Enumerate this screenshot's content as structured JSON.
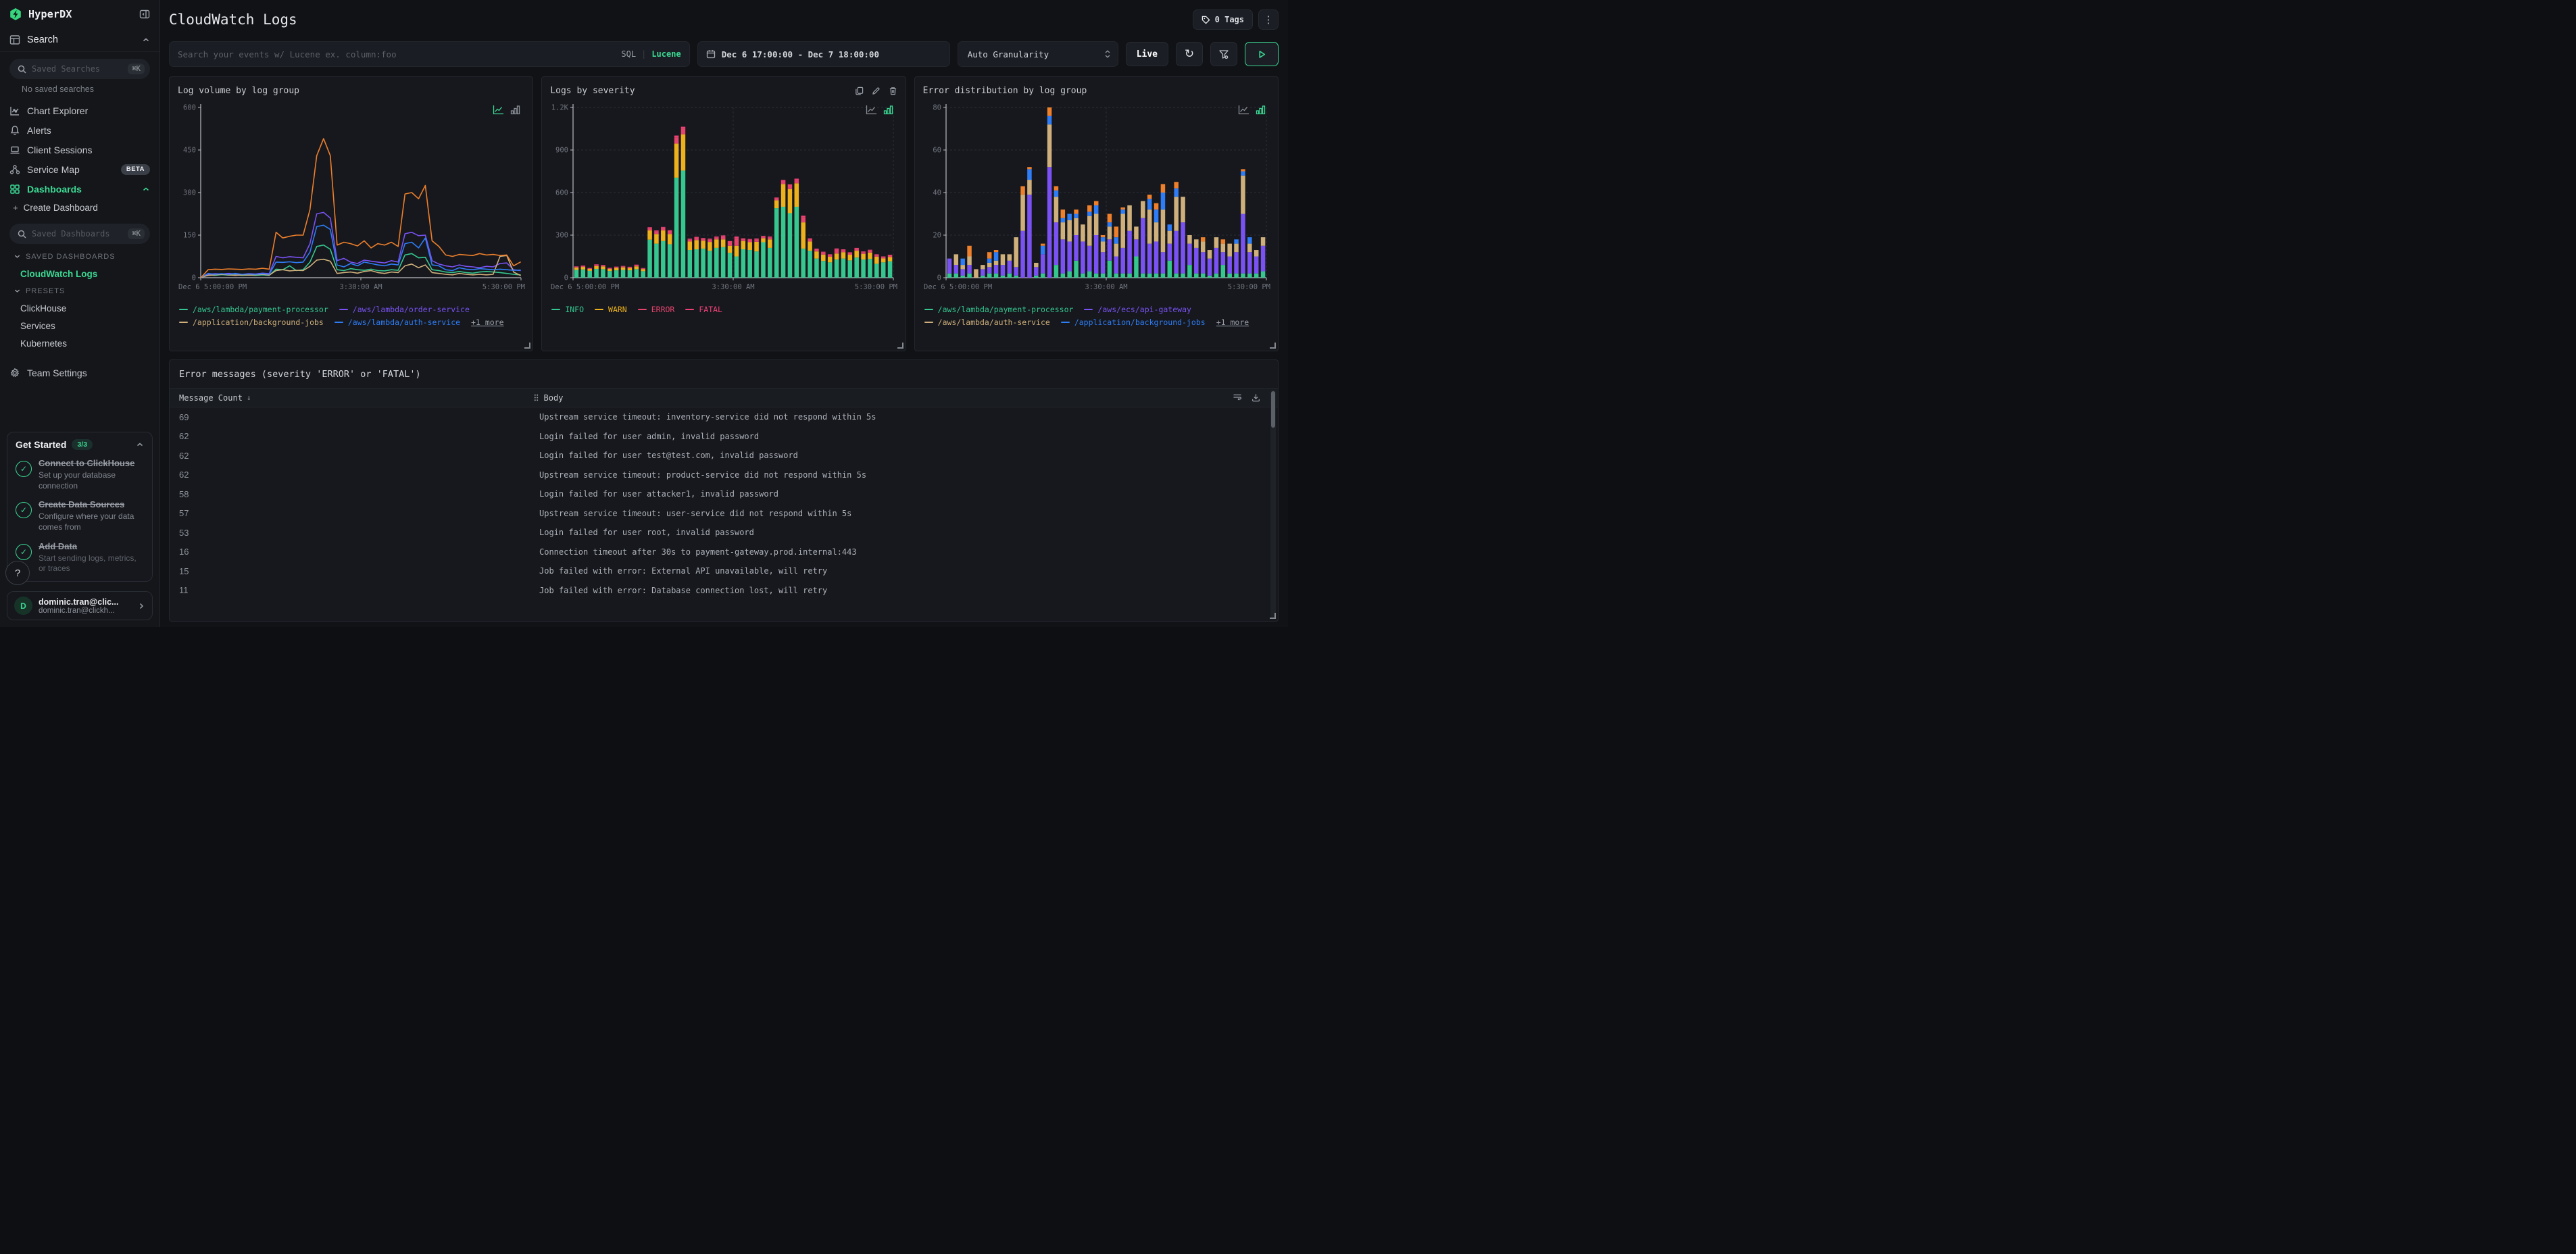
{
  "icons": {
    "kebab": "⋮",
    "refresh": "↻",
    "cmdk": "⌘K",
    "help": "?",
    "plus": "+",
    "sort_desc": "↓",
    "check": "✓",
    "avatar_letter": "D"
  },
  "sidebar": {
    "brand": "HyperDX",
    "search_section": {
      "label": "Search",
      "placeholder": "Saved Searches",
      "empty": "No saved searches"
    },
    "nav": [
      {
        "label": "Chart Explorer"
      },
      {
        "label": "Alerts"
      },
      {
        "label": "Client Sessions"
      },
      {
        "label": "Service Map",
        "badge": "BETA"
      },
      {
        "label": "Dashboards"
      }
    ],
    "dashboards": {
      "create": "Create Dashboard",
      "placeholder": "Saved Dashboards",
      "saved_label": "SAVED DASHBOARDS",
      "saved_items": [
        {
          "label": "CloudWatch Logs",
          "active": true
        }
      ],
      "presets_label": "PRESETS",
      "presets": [
        "ClickHouse",
        "Services",
        "Kubernetes"
      ]
    },
    "team_settings": "Team Settings",
    "get_started": {
      "title": "Get Started",
      "badge": "3/3",
      "items": [
        {
          "title": "Connect to ClickHouse",
          "desc": "Set up your database connection"
        },
        {
          "title": "Create Data Sources",
          "desc": "Configure where your data comes from"
        },
        {
          "title": "Add Data",
          "desc": "Start sending logs, metrics, or traces"
        }
      ]
    },
    "user": {
      "name": "dominic.tran@clic...",
      "email": "dominic.tran@clickh..."
    }
  },
  "header": {
    "title": "CloudWatch Logs",
    "tags": "0 Tags",
    "search_placeholder": "Search your events w/ Lucene ex. column:foo",
    "sql": "SQL",
    "pipe": "|",
    "lucene": "Lucene",
    "date_range": "Dec 6 17:00:00 - Dec 7 18:00:00",
    "granularity": "Auto Granularity",
    "live": "Live"
  },
  "chart_data": [
    {
      "type": "line",
      "title": "Log volume by log group",
      "active_view": "line",
      "grid": false,
      "ylim": [
        0,
        600
      ],
      "yticks": [
        [
          0,
          "0"
        ],
        [
          150,
          "150"
        ],
        [
          300,
          "300"
        ],
        [
          450,
          "450"
        ],
        [
          600,
          "600"
        ]
      ],
      "xticklabels": [
        "Dec 6 5:00:00 PM",
        "3:30:00 AM",
        "5:30:00 PM"
      ],
      "series": [
        {
          "name": "/aws/lambda/payment-processor",
          "color": "#35c78f",
          "values": [
            2,
            10,
            8,
            11,
            9,
            10,
            8,
            9,
            8,
            10,
            8,
            30,
            28,
            42,
            25,
            28,
            55,
            110,
            115,
            100,
            28,
            25,
            32,
            28,
            26,
            30,
            25,
            24,
            28,
            26,
            80,
            85,
            70,
            72,
            28,
            25,
            20,
            18,
            22,
            18,
            16,
            20,
            22,
            20,
            18,
            15,
            12,
            10
          ]
        },
        {
          "name": "/aws/lambda/order-service",
          "color": "#7a52f4",
          "values": [
            2,
            12,
            14,
            13,
            15,
            13,
            12,
            14,
            13,
            16,
            14,
            75,
            70,
            74,
            72,
            70,
            120,
            225,
            230,
            210,
            60,
            68,
            55,
            50,
            62,
            58,
            55,
            52,
            60,
            55,
            155,
            160,
            148,
            150,
            60,
            48,
            42,
            38,
            45,
            40,
            38,
            35,
            40,
            38,
            50,
            52,
            28,
            25
          ]
        },
        {
          "name": "/application/background-jobs",
          "color": "#cfb07c",
          "values": [
            2,
            8,
            10,
            12,
            10,
            8,
            10,
            9,
            10,
            12,
            9,
            25,
            28,
            24,
            26,
            25,
            40,
            62,
            65,
            58,
            15,
            18,
            20,
            16,
            22,
            25,
            18,
            15,
            20,
            18,
            42,
            48,
            35,
            45,
            18,
            15,
            12,
            10,
            15,
            12,
            10,
            12,
            10,
            12,
            75,
            78,
            20,
            8
          ]
        },
        {
          "name": "/aws/lambda/auth-service",
          "color": "#2e7df6",
          "values": [
            2,
            15,
            12,
            14,
            12,
            15,
            12,
            13,
            12,
            14,
            12,
            55,
            54,
            56,
            53,
            55,
            90,
            180,
            185,
            170,
            45,
            38,
            50,
            42,
            55,
            50,
            45,
            42,
            48,
            45,
            120,
            125,
            105,
            140,
            45,
            42,
            28,
            25,
            35,
            30,
            28,
            32,
            30,
            28,
            30,
            28,
            26,
            27
          ]
        },
        {
          "name": "/aws/ecs/api-gateway",
          "color": "#ee7f2b",
          "values": [
            2,
            28,
            30,
            29,
            31,
            30,
            29,
            31,
            30,
            33,
            30,
            160,
            140,
            146,
            150,
            150,
            240,
            430,
            490,
            430,
            115,
            125,
            120,
            112,
            130,
            105,
            120,
            115,
            125,
            110,
            295,
            300,
            278,
            325,
            130,
            110,
            80,
            75,
            82,
            80,
            78,
            85,
            80,
            82,
            78,
            80,
            42,
            55
          ]
        }
      ],
      "legend_rows": [
        [
          0,
          1
        ],
        [
          2,
          3
        ]
      ],
      "legend_more": "+1 more"
    },
    {
      "type": "bar",
      "title": "Logs by severity",
      "active_view": "bar",
      "grid": true,
      "has_actions": true,
      "ylim": [
        0,
        1200
      ],
      "yticks": [
        [
          0,
          "0"
        ],
        [
          300,
          "300"
        ],
        [
          600,
          "600"
        ],
        [
          900,
          "900"
        ],
        [
          1200,
          "1.2K"
        ]
      ],
      "xticklabels": [
        "Dec 6 5:00:00 PM",
        "3:30:00 AM",
        "5:30:00 PM"
      ],
      "series": [
        {
          "name": "INFO",
          "color": "#35c78f",
          "values": [
            55,
            58,
            48,
            62,
            60,
            47,
            52,
            55,
            52,
            60,
            46,
            268,
            240,
            258,
            236,
            705,
            755,
            195,
            200,
            205,
            190,
            210,
            215,
            175,
            150,
            200,
            195,
            185,
            250,
            210,
            490,
            500,
            455,
            500,
            205,
            190,
            135,
            118,
            108,
            128,
            135,
            122,
            142,
            128,
            132,
            98,
            108,
            115
          ]
        },
        {
          "name": "WARN",
          "color": "#edb11c",
          "values": [
            16,
            18,
            14,
            20,
            19,
            15,
            17,
            18,
            16,
            20,
            15,
            65,
            68,
            75,
            72,
            240,
            255,
            60,
            65,
            55,
            62,
            60,
            55,
            50,
            75,
            58,
            55,
            68,
            28,
            60,
            55,
            160,
            170,
            165,
            185,
            65,
            50,
            45,
            40,
            42,
            45,
            40,
            48,
            40,
            45,
            50,
            28,
            30
          ]
        },
        {
          "name": "ERROR",
          "color": "#e5446d",
          "values": [
            6,
            7,
            5,
            8,
            8,
            6,
            6,
            7,
            6,
            8,
            5,
            18,
            20,
            20,
            22,
            45,
            42,
            15,
            18,
            15,
            18,
            15,
            20,
            25,
            55,
            15,
            18,
            18,
            12,
            15,
            15,
            22,
            25,
            25,
            35,
            18,
            15,
            15,
            12,
            28,
            15,
            12,
            15,
            12,
            15,
            12,
            10,
            12
          ]
        },
        {
          "name": "FATAL",
          "color": "#ef4075",
          "values": [
            3,
            3,
            2,
            4,
            3,
            2,
            3,
            3,
            3,
            4,
            2,
            5,
            5,
            5,
            5,
            12,
            12,
            5,
            5,
            5,
            5,
            5,
            8,
            8,
            10,
            5,
            5,
            5,
            5,
            5,
            5,
            8,
            8,
            8,
            12,
            5,
            5,
            5,
            5,
            8,
            5,
            5,
            5,
            5,
            5,
            5,
            4,
            5
          ]
        }
      ],
      "legend_rows": [
        [
          0,
          1,
          2,
          3
        ]
      ],
      "legend_more": null
    },
    {
      "type": "bar",
      "title": "Error distribution by log group",
      "active_view": "bar",
      "grid": true,
      "ylim": [
        0,
        80
      ],
      "yticks": [
        [
          0,
          "0"
        ],
        [
          20,
          "20"
        ],
        [
          40,
          "40"
        ],
        [
          60,
          "60"
        ],
        [
          80,
          "80"
        ]
      ],
      "xticklabels": [
        "Dec 6 5:00:00 PM",
        "3:30:00 AM",
        "5:30:00 PM"
      ],
      "series": [
        {
          "name": "/aws/lambda/payment-processor",
          "color": "#35c78f",
          "values": [
            2,
            2,
            1,
            2,
            0,
            1,
            2,
            2,
            1,
            2,
            1,
            0,
            0,
            1,
            2,
            0,
            6,
            2,
            3,
            8,
            2,
            3,
            2,
            2,
            8,
            2,
            2,
            2,
            10,
            2,
            2,
            2,
            2,
            8,
            2,
            2,
            6,
            2,
            2,
            1,
            2,
            6,
            2,
            2,
            2,
            2,
            2,
            3
          ]
        },
        {
          "name": "/aws/ecs/api-gateway",
          "color": "#7a52f4",
          "values": [
            7,
            4,
            3,
            4,
            0,
            3,
            3,
            4,
            5,
            6,
            4,
            22,
            39,
            4,
            9,
            52,
            20,
            16,
            14,
            12,
            15,
            12,
            18,
            10,
            10,
            8,
            12,
            20,
            8,
            26,
            14,
            15,
            10,
            8,
            20,
            24,
            10,
            12,
            10,
            8,
            12,
            6,
            8,
            10,
            28,
            10,
            8,
            12
          ]
        },
        {
          "name": "/aws/lambda/auth-service",
          "color": "#cfb07c",
          "values": [
            0,
            5,
            2,
            4,
            4,
            2,
            2,
            2,
            5,
            3,
            14,
            17,
            7,
            2,
            0,
            20,
            12,
            8,
            10,
            8,
            8,
            14,
            10,
            5,
            6,
            6,
            16,
            12,
            6,
            8,
            16,
            9,
            20,
            6,
            16,
            12,
            4,
            4,
            5,
            4,
            5,
            4,
            6,
            4,
            18,
            4,
            3,
            4
          ]
        },
        {
          "name": "/application/background-jobs",
          "color": "#2e7df6",
          "values": [
            0,
            0,
            3,
            0,
            0,
            0,
            2,
            4,
            0,
            0,
            0,
            0,
            5,
            0,
            4,
            4,
            3,
            2,
            3,
            2,
            0,
            2,
            4,
            2,
            2,
            3,
            2,
            0,
            0,
            0,
            5,
            6,
            8,
            3,
            4,
            0,
            0,
            0,
            0,
            0,
            0,
            0,
            0,
            2,
            2,
            3,
            0,
            0
          ]
        },
        {
          "name": "/aws/lambda/order-service",
          "color": "#ee7f2b",
          "values": [
            0,
            0,
            0,
            5,
            0,
            0,
            3,
            1,
            0,
            0,
            0,
            4,
            1,
            0,
            1,
            5,
            2,
            4,
            0,
            2,
            0,
            3,
            2,
            1,
            4,
            5,
            1,
            0,
            0,
            0,
            2,
            3,
            4,
            0,
            3,
            0,
            0,
            0,
            2,
            0,
            0,
            2,
            0,
            0,
            1,
            0,
            0,
            0
          ]
        }
      ],
      "legend_rows": [
        [
          0,
          1
        ],
        [
          2,
          3
        ]
      ],
      "legend_more": "+1 more"
    }
  ],
  "table": {
    "title": "Error messages (severity 'ERROR' or 'FATAL')",
    "columns": {
      "count": "Message Count",
      "body": "Body"
    },
    "rows": [
      {
        "count": "69",
        "body": "Upstream service timeout: inventory-service did not respond within 5s"
      },
      {
        "count": "62",
        "body": "Login failed for user admin, invalid password"
      },
      {
        "count": "62",
        "body": "Login failed for user test@test.com, invalid password"
      },
      {
        "count": "62",
        "body": "Upstream service timeout: product-service did not respond within 5s"
      },
      {
        "count": "58",
        "body": "Login failed for user attacker1, invalid password"
      },
      {
        "count": "57",
        "body": "Upstream service timeout: user-service did not respond within 5s"
      },
      {
        "count": "53",
        "body": "Login failed for user root, invalid password"
      },
      {
        "count": "16",
        "body": "Connection timeout after 30s to payment-gateway.prod.internal:443"
      },
      {
        "count": "15",
        "body": "Job failed with error: External API unavailable, will retry"
      },
      {
        "count": "11",
        "body": "Job failed with error: Database connection lost, will retry"
      }
    ]
  }
}
